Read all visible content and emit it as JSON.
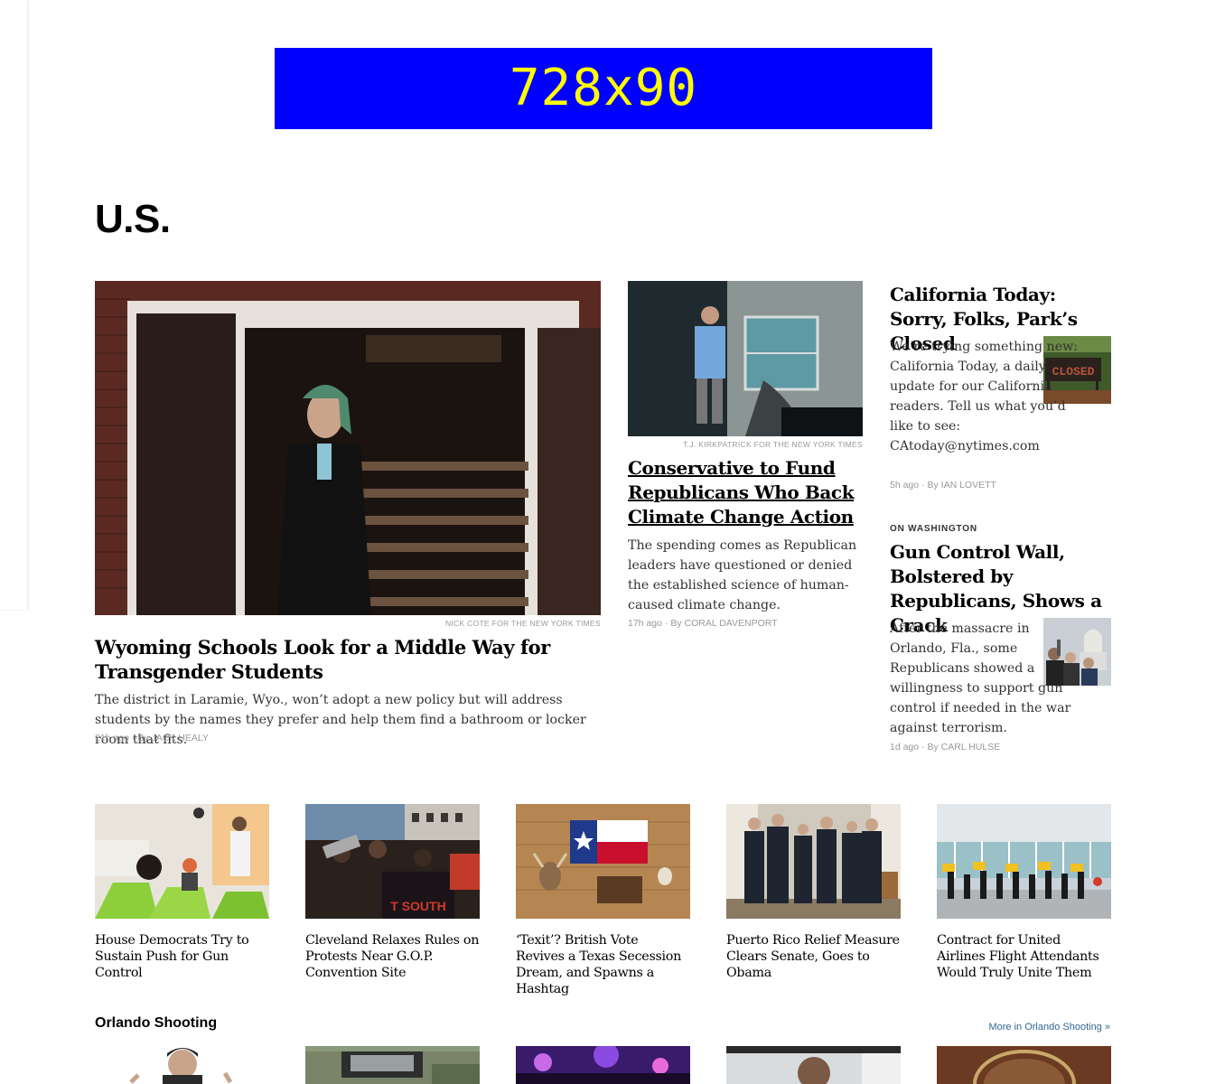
{
  "ad": {
    "label": "728x90"
  },
  "section": {
    "title": "U.S."
  },
  "lead": {
    "credit": "NICK COTE FOR THE NEW YORK TIMES",
    "headline": "Wyoming Schools Look for a Middle Way for Transgender Students",
    "summary": "The district in Laramie, Wyo., won’t adopt a new policy but will address students by the names they prefer and help them find a bathroom or locker room that fits.",
    "time": "21h ago",
    "by": "By",
    "author": "JACK HEALY"
  },
  "second": {
    "credit": "T.J. KIRKPATRICK FOR THE NEW YORK TIMES",
    "headline": "Conservative to Fund Republicans Who Back Climate Change Action",
    "summary": "The spending comes as Republican leaders have questioned or denied the established science of human-caused climate change.",
    "time": "17h ago",
    "by": "By",
    "author": "CORAL DAVENPORT"
  },
  "california": {
    "headline": "California Today: Sorry, Folks, Park’s Closed",
    "summary": "We’re trying something new: California Today, a daily update for our California readers. Tell us what you’d like to see: CAtoday@nytimes.com",
    "time": "5h ago",
    "by": "By",
    "author": "IAN LOVETT"
  },
  "gun": {
    "kicker": "ON WASHINGTON",
    "headline": "Gun Control Wall, Bolstered by Republicans, Shows a Crack",
    "summary": "After the massacre in Orlando, Fla., some Republicans showed a willingness to support gun control if needed in the war against terrorism.",
    "time": "1d ago",
    "by": "By",
    "author": "CARL HULSE"
  },
  "row": [
    {
      "headline": "House Democrats Try to Sustain Push for Gun Control"
    },
    {
      "headline": "Cleveland Relaxes Rules on Protests Near G.O.P. Convention Site"
    },
    {
      "headline": "‘Texit’? British Vote Revives a Texas Secession Dream, and Spawns a Hashtag"
    },
    {
      "headline": "Puerto Rico Relief Measure Clears Senate, Goes to Obama"
    },
    {
      "headline": "Contract for United Airlines Flight Attendants Would Truly Unite Them"
    }
  ],
  "orlando": {
    "title": "Orlando Shooting",
    "more": "More in Orlando Shooting »"
  },
  "colors": {
    "ad_bg": "#0000ff",
    "ad_text": "#ffff00",
    "link": "#326891"
  }
}
